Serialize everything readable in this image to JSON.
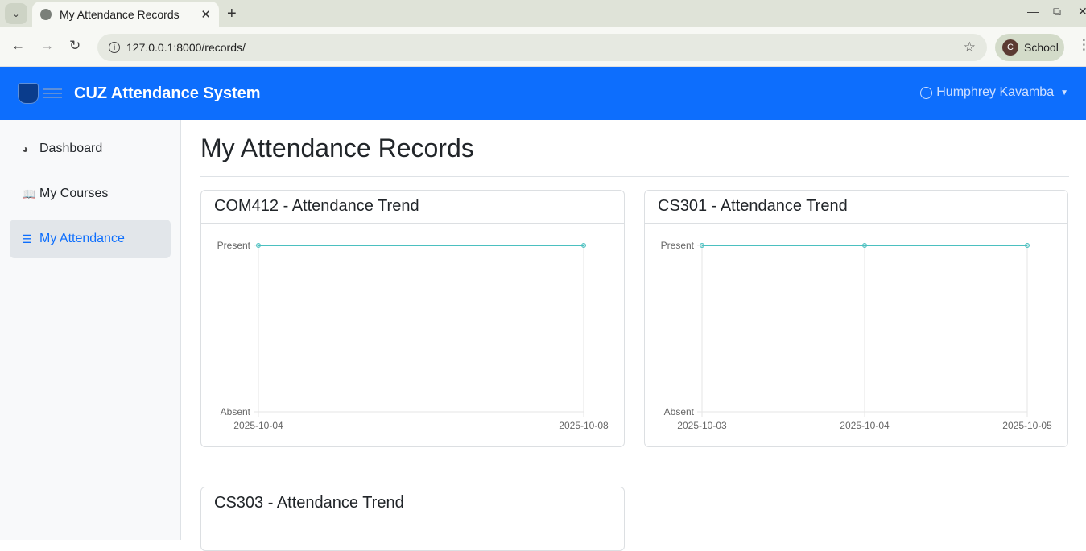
{
  "browser": {
    "tab_title": "My Attendance Records",
    "url": "127.0.0.1:8000/records/",
    "profile_initial": "C",
    "profile_name": "School"
  },
  "app": {
    "brand": "CUZ Attendance System",
    "user_name": "Humphrey Kavamba"
  },
  "sidebar": {
    "items": [
      {
        "label": "Dashboard",
        "icon": "speedometer-icon"
      },
      {
        "label": "My Courses",
        "icon": "book-icon"
      },
      {
        "label": "My Attendance",
        "icon": "list-icon",
        "active": true
      }
    ]
  },
  "page": {
    "title": "My Attendance Records"
  },
  "cards": [
    {
      "title": "COM412 - Attendance Trend"
    },
    {
      "title": "CS301 - Attendance Trend"
    },
    {
      "title": "CS303 - Attendance Trend"
    }
  ],
  "chart_data": [
    {
      "type": "line",
      "title": "COM412 - Attendance Trend",
      "x": [
        "2025-10-04",
        "2025-10-08"
      ],
      "y_categories": [
        "Absent",
        "Present"
      ],
      "values": [
        "Present",
        "Present"
      ],
      "color": "#4bc0c0"
    },
    {
      "type": "line",
      "title": "CS301 - Attendance Trend",
      "x": [
        "2025-10-03",
        "2025-10-04",
        "2025-10-05"
      ],
      "y_categories": [
        "Absent",
        "Present"
      ],
      "values": [
        "Present",
        "Present",
        "Present"
      ],
      "color": "#4bc0c0"
    }
  ]
}
